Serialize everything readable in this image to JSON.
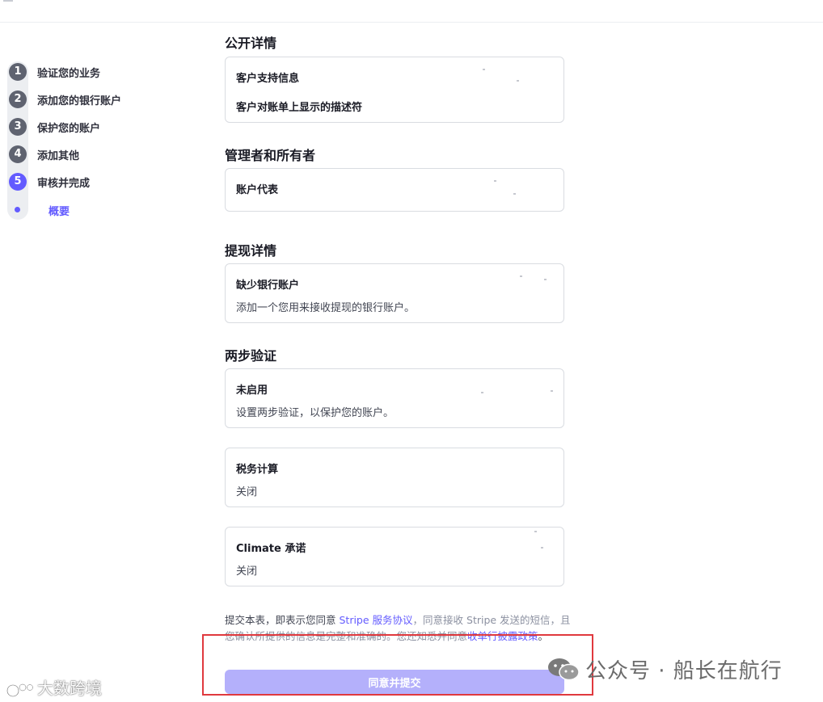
{
  "sidebar": {
    "steps": [
      {
        "num": "1",
        "label": "验证您的业务"
      },
      {
        "num": "2",
        "label": "添加您的银行账户"
      },
      {
        "num": "3",
        "label": "保护您的账户"
      },
      {
        "num": "4",
        "label": "添加其他"
      },
      {
        "num": "5",
        "label": "审核并完成"
      }
    ],
    "substep": "概要"
  },
  "sections": {
    "public": {
      "title": "公开详情",
      "rows": [
        "客户支持信息",
        "客户对账单上显示的描述符"
      ]
    },
    "managers": {
      "title": "管理者和所有者",
      "rows": [
        "账户代表"
      ]
    },
    "payouts": {
      "title": "提现详情",
      "row_title": "缺少银行账户",
      "row_sub": "添加一个您用来接收提现的银行账户。"
    },
    "twofa": {
      "title": "两步验证",
      "row_title": "未启用",
      "row_sub": "设置两步验证，以保护您的账户。"
    },
    "tax": {
      "row_title": "税务计算",
      "row_sub": "关闭"
    },
    "climate": {
      "row_title": "Climate 承诺",
      "row_sub": "关闭"
    }
  },
  "legal": {
    "part1": "提交本表，即表示您同意 ",
    "link1": "Stripe 服务协议",
    "part2": "，同意接收 Stripe 发送的短信，且您确认所提供的信息是完整和准确的。您还知悉并同意",
    "link2": "收单行披露政策",
    "part3": "。"
  },
  "submit_label": "同意并提交",
  "colors": {
    "accent": "#635bff",
    "accent_disabled": "#b4b0fb",
    "highlight_box": "#e0393e"
  },
  "watermarks": {
    "left": "大数跨境",
    "right": "公众号 · 船长在航行"
  }
}
